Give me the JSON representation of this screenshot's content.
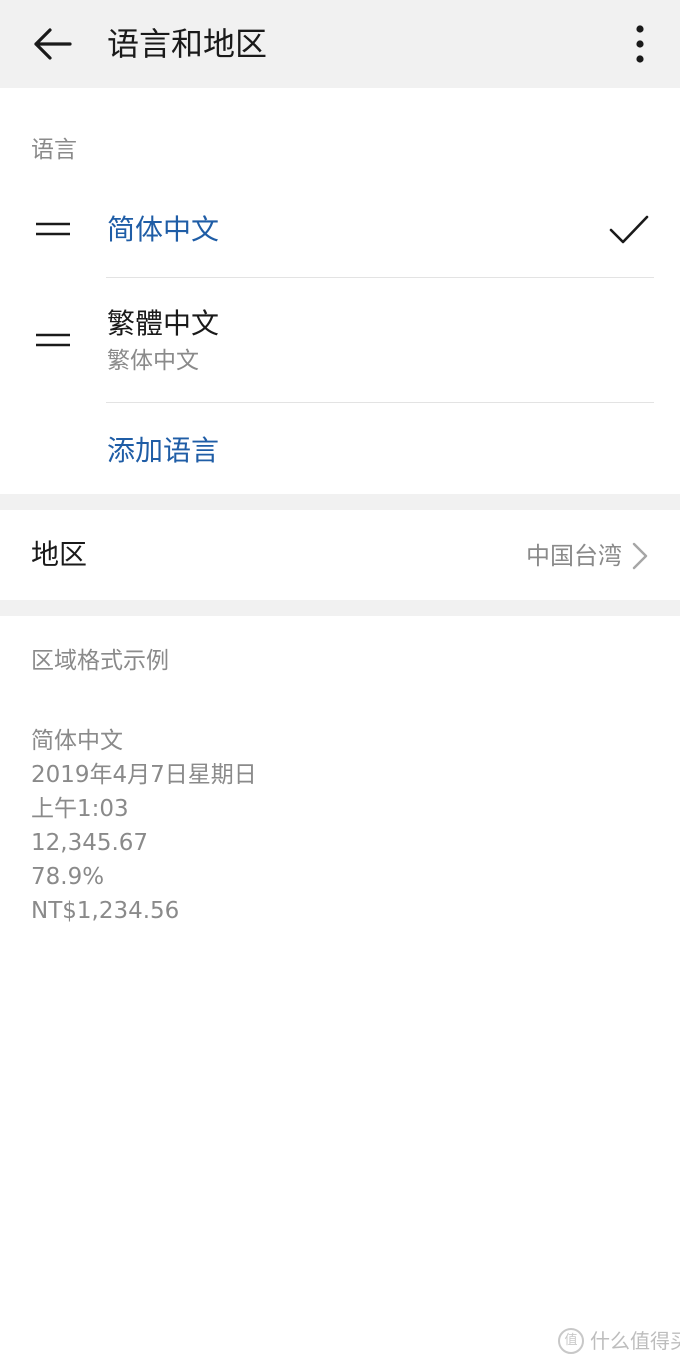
{
  "appbar": {
    "title": "语言和地区",
    "back_icon": "arrow-left-icon",
    "more_icon": "more-vertical-icon"
  },
  "language_section": {
    "header": "语言",
    "languages": [
      {
        "name": "简体中文",
        "subtitle": "",
        "selected": true
      },
      {
        "name": "繁體中文",
        "subtitle": "繁体中文",
        "selected": false
      }
    ],
    "add_language": "添加语言"
  },
  "region": {
    "label": "地区",
    "value": "中国台湾"
  },
  "format_examples": {
    "header": "区域格式示例",
    "lines": [
      "简体中文",
      "2019年4月7日星期日",
      "上午1:03",
      "12,345.67",
      "78.9%",
      "NT$1,234.56"
    ]
  },
  "watermark": {
    "badge": "值",
    "text": "什么值得买"
  },
  "colors": {
    "accent": "#1f5da6",
    "appbar_bg": "#f1f1f1",
    "secondary_text": "#8a8a8a",
    "divider": "#e3e3e3"
  }
}
